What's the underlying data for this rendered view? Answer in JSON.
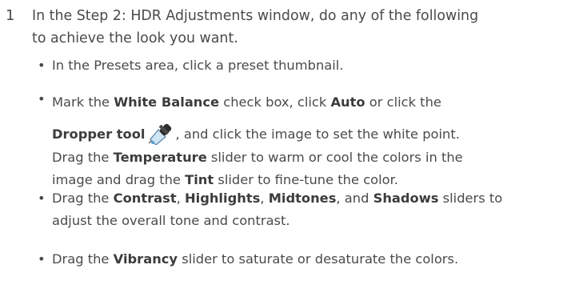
{
  "step": {
    "number": "1",
    "line1": "In the Step 2: HDR Adjustments window, do any of the following",
    "line2": "to achieve the look you want."
  },
  "bullets": {
    "b1": "In the Presets area, click a preset thumbnail.",
    "b2": {
      "t1": "Mark the ",
      "white_balance": "White Balance",
      "t2": " check box, click ",
      "auto": "Auto",
      "t3": " or click the",
      "dropper_tool": "Dropper tool",
      "t4": ", and click the image to set the white point.",
      "t5": "Drag the ",
      "temperature": "Temperature",
      "t6": " slider to warm or cool the colors in the",
      "t7": "image and drag the ",
      "tint": "Tint",
      "t8": " slider to fine-tune the color."
    },
    "b3": {
      "t1": "Drag the ",
      "contrast": "Contrast",
      "c1": ", ",
      "highlights": "Highlights",
      "c2": ", ",
      "midtones": "Midtones",
      "t2": ", and ",
      "shadows": "Shadows",
      "t3": " sliders to",
      "t4": "adjust the overall tone and contrast."
    },
    "b4": {
      "t1": "Drag the ",
      "vibrancy": "Vibrancy",
      "t2": " slider to saturate or desaturate the colors."
    }
  },
  "icons": {
    "dropper": "dropper-icon"
  },
  "colors": {
    "text": "#4a4a4a",
    "bold": "#3c3c3c"
  }
}
